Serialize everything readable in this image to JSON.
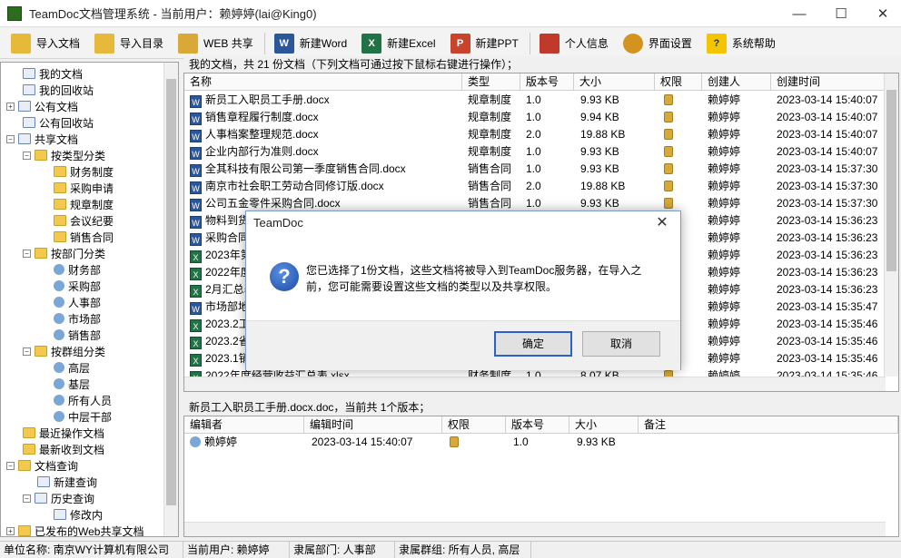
{
  "window": {
    "title": "TeamDoc文档管理系统 - 当前用户：赖婷婷(lai@King0)",
    "min_glyph": "—",
    "max_glyph": "☐",
    "close_glyph": "✕"
  },
  "toolbar": {
    "items": [
      {
        "label": "导入文档",
        "icon": "import-file-icon"
      },
      {
        "label": "导入目录",
        "icon": "import-folder-icon"
      },
      {
        "label": "WEB 共享",
        "icon": "web-share-icon"
      },
      {
        "label": "新建Word",
        "icon": "word-icon"
      },
      {
        "label": "新建Excel",
        "icon": "excel-icon"
      },
      {
        "label": "新建PPT",
        "icon": "ppt-icon"
      },
      {
        "label": "个人信息",
        "icon": "personal-info-icon"
      },
      {
        "label": "界面设置",
        "icon": "gear-icon"
      },
      {
        "label": "系统帮助",
        "icon": "help-icon"
      }
    ]
  },
  "tree": {
    "items": [
      {
        "label": "我的文档"
      },
      {
        "label": "我的回收站"
      },
      {
        "label": "公有文档"
      },
      {
        "label": "公有回收站"
      },
      {
        "label": "共享文档"
      },
      {
        "label": "按类型分类"
      },
      {
        "label": "财务制度"
      },
      {
        "label": "采购申请"
      },
      {
        "label": "规章制度"
      },
      {
        "label": "会议纪要"
      },
      {
        "label": "销售合同"
      },
      {
        "label": "按部门分类"
      },
      {
        "label": "财务部"
      },
      {
        "label": "采购部"
      },
      {
        "label": "人事部"
      },
      {
        "label": "市场部"
      },
      {
        "label": "销售部"
      },
      {
        "label": "按群组分类"
      },
      {
        "label": "高层"
      },
      {
        "label": "基层"
      },
      {
        "label": "所有人员"
      },
      {
        "label": "中层干部"
      },
      {
        "label": "最近操作文档"
      },
      {
        "label": "最新收到文档"
      },
      {
        "label": "文档查询"
      },
      {
        "label": "新建查询"
      },
      {
        "label": "历史查询"
      },
      {
        "label": "修改内"
      },
      {
        "label": "已发布的Web共享文档"
      }
    ]
  },
  "doclist": {
    "caption": "我的文档，共 21 份文档（下列文档可通过按下鼠标右键进行操作）；",
    "columns": [
      "名称",
      "类型",
      "版本号",
      "大小",
      "权限",
      "创建人",
      "创建时间"
    ],
    "rows": [
      {
        "name": "新员工入职员工手册.docx",
        "type": "规章制度",
        "ver": "1.0",
        "size": "9.93 KB",
        "owner": "赖婷婷",
        "time": "2023-03-14 15:40:07",
        "kind": "W"
      },
      {
        "name": "销售章程履行制度.docx",
        "type": "规章制度",
        "ver": "1.0",
        "size": "9.94 KB",
        "owner": "赖婷婷",
        "time": "2023-03-14 15:40:07",
        "kind": "W"
      },
      {
        "name": "人事档案整理规范.docx",
        "type": "规章制度",
        "ver": "2.0",
        "size": "19.88 KB",
        "owner": "赖婷婷",
        "time": "2023-03-14 15:40:07",
        "kind": "W"
      },
      {
        "name": "企业内部行为准则.docx",
        "type": "规章制度",
        "ver": "1.0",
        "size": "9.93 KB",
        "owner": "赖婷婷",
        "time": "2023-03-14 15:40:07",
        "kind": "W"
      },
      {
        "name": "全其科技有限公司第一季度销售合同.docx",
        "type": "销售合同",
        "ver": "1.0",
        "size": "9.93 KB",
        "owner": "赖婷婷",
        "time": "2023-03-14 15:37:30",
        "kind": "W"
      },
      {
        "name": "南京市社会职工劳动合同修订版.docx",
        "type": "销售合同",
        "ver": "2.0",
        "size": "19.88 KB",
        "owner": "赖婷婷",
        "time": "2023-03-14 15:37:30",
        "kind": "W"
      },
      {
        "name": "公司五金零件采购合同.docx",
        "type": "销售合同",
        "ver": "1.0",
        "size": "9.93 KB",
        "owner": "赖婷婷",
        "time": "2023-03-14 15:37:30",
        "kind": "W"
      },
      {
        "name": "物料到货",
        "type": "",
        "ver": "",
        "size": "",
        "owner": "赖婷婷",
        "time": "2023-03-14 15:36:23",
        "kind": "W"
      },
      {
        "name": "采购合同",
        "type": "",
        "ver": "",
        "size": "",
        "owner": "赖婷婷",
        "time": "2023-03-14 15:36:23",
        "kind": "W"
      },
      {
        "name": "2023年第",
        "type": "",
        "ver": "",
        "size": "",
        "owner": "赖婷婷",
        "time": "2023-03-14 15:36:23",
        "kind": "X"
      },
      {
        "name": "2022年度",
        "type": "",
        "ver": "",
        "size": "",
        "owner": "赖婷婷",
        "time": "2023-03-14 15:36:23",
        "kind": "X"
      },
      {
        "name": "2月汇总表",
        "type": "",
        "ver": "",
        "size": "",
        "owner": "赖婷婷",
        "time": "2023-03-14 15:36:23",
        "kind": "X"
      },
      {
        "name": "市场部地",
        "type": "",
        "ver": "",
        "size": "",
        "owner": "赖婷婷",
        "time": "2023-03-14 15:35:47",
        "kind": "W"
      },
      {
        "name": "2023.2工",
        "type": "",
        "ver": "",
        "size": "",
        "owner": "赖婷婷",
        "time": "2023-03-14 15:35:46",
        "kind": "X"
      },
      {
        "name": "2023.2省",
        "type": "",
        "ver": "",
        "size": "",
        "owner": "赖婷婷",
        "time": "2023-03-14 15:35:46",
        "kind": "X"
      },
      {
        "name": "2023.1销",
        "type": "",
        "ver": "",
        "size": "",
        "owner": "赖婷婷",
        "time": "2023-03-14 15:35:46",
        "kind": "X"
      },
      {
        "name": "2022年度经营收益汇总表.xlsx",
        "type": "财务制度",
        "ver": "1.0",
        "size": "8.07 KB",
        "owner": "赖婷婷",
        "time": "2023-03-14 15:35:46",
        "kind": "X"
      }
    ]
  },
  "versions": {
    "caption": "新员工入职员工手册.docx.doc，当前共 1个版本；",
    "columns": [
      "编辑者",
      "编辑时间",
      "权限",
      "版本号",
      "大小",
      "备注"
    ],
    "rows": [
      {
        "editor": "赖婷婷",
        "time": "2023-03-14 15:40:07",
        "ver": "1.0",
        "size": "9.93 KB",
        "note": ""
      }
    ]
  },
  "status": {
    "company": "单位名称: 南京WY计算机有限公司",
    "user": "当前用户: 赖婷婷",
    "dept": "隶属部门: 人事部",
    "group": "隶属群组: 所有人员, 高层"
  },
  "dialog": {
    "title": "TeamDoc",
    "message": "您已选择了1份文档，这些文档将被导入到TeamDoc服务器，在导入之前，您可能需要设置这些文档的类型以及共享权限。",
    "ok": "确定",
    "cancel": "取消",
    "close_glyph": "✕",
    "question_glyph": "?"
  }
}
